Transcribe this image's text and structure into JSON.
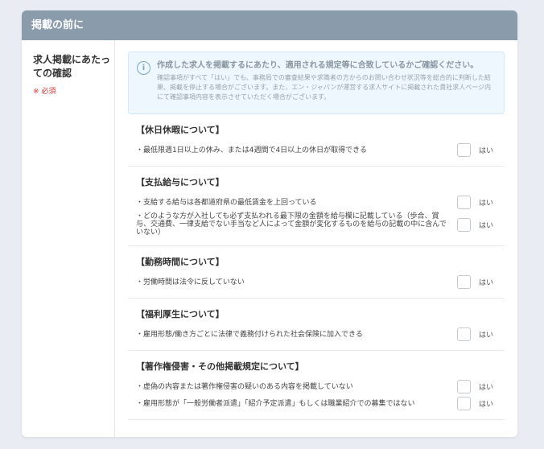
{
  "header": {
    "title": "掲載の前に"
  },
  "field": {
    "label": "求人掲載にあたっての確認",
    "required": "※ 必須"
  },
  "notice": {
    "main": "作成した求人を掲載するにあたり、適用される規定等に合致しているかご確認ください。",
    "sub": "確認事項がすべて「はい」でも、事務局での審査結果や求職者の方からのお問い合わせ状況等を総合的に判断した結果、掲載を停止する場合がございます。また、エン・ジャパンが運営する求人サイトに掲載された貴社求人ページ内にて確認事項内容を表示させていただく場合がございます。"
  },
  "sections": [
    {
      "title": "【休日休暇について】",
      "items": [
        {
          "text": "・最低限週1日以上の休み、または4週間で4日以上の休日が取得できる",
          "check_label": "はい"
        }
      ]
    },
    {
      "title": "【支払給与について】",
      "items": [
        {
          "text": "・支給する給与は各都道府県の最低賃金を上回っている",
          "check_label": "はい"
        },
        {
          "text": "・どのような方が入社しても必ず支払われる最下限の金額を給与欄に記載している（歩合、賞与、交通費、一律支給でない手当など人によって金額が変化するものを給与の記載の中に含んでいない）",
          "check_label": "はい"
        }
      ]
    },
    {
      "title": "【勤務時間について】",
      "items": [
        {
          "text": "・労働時間は法令に反していない",
          "check_label": "はい"
        }
      ]
    },
    {
      "title": "【福利厚生について】",
      "items": [
        {
          "text": "・雇用形態/働き方ごとに法律で義務付けられた社会保険に加入できる",
          "check_label": "はい"
        }
      ]
    },
    {
      "title": "【著作権侵害・その他掲載規定について】",
      "items": [
        {
          "text": "・虚偽の内容または著作権侵害の疑いのある内容を掲載していない",
          "check_label": "はい"
        },
        {
          "text": "・雇用形態が「一般労働者派遣」「紹介予定派遣」もしくは職業紹介での募集ではない",
          "check_label": "はい"
        }
      ]
    }
  ]
}
